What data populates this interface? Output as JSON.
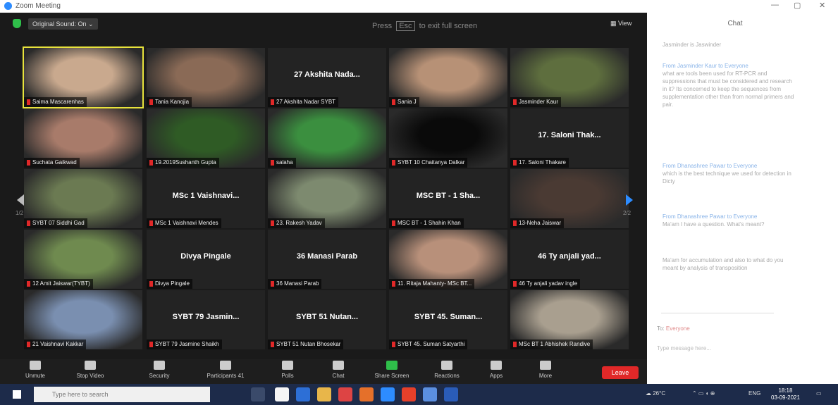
{
  "window": {
    "title": "Zoom Meeting",
    "controls": [
      "—",
      "▢",
      "✕"
    ]
  },
  "topbar": {
    "sound": "Original Sound: On  ⌄",
    "fullscreen_prefix": "Press",
    "fullscreen_key": "Esc",
    "fullscreen_suffix": "to exit full screen",
    "view": "View"
  },
  "tiles": [
    {
      "name": "Saima Mascarenhas",
      "video": true,
      "bg": "#c9a98e",
      "active": true
    },
    {
      "name": "Tania Kanojia",
      "video": true,
      "bg": "#8a6a56"
    },
    {
      "name": "27 Akshita Nadar SYBT",
      "big": "27 Akshita Nada...",
      "video": false
    },
    {
      "name": "Sania J",
      "video": true,
      "bg": "#b79176"
    },
    {
      "name": "Jasminder Kaur",
      "video": true,
      "bg": "#5e6e3e"
    },
    {
      "name": "Suchata Gaikwad",
      "video": true,
      "bg": "#a87b6a"
    },
    {
      "name": "19.2019Sushanth Gupta",
      "video": true,
      "bg": "#2f5b25"
    },
    {
      "name": "salaha",
      "video": true,
      "bg": "#3b8f3f"
    },
    {
      "name": "SYBT 10 Chaitanya Dalkar",
      "video": true,
      "bg": "#0a0a0a"
    },
    {
      "name": "17. Saloni Thakare",
      "big": "17. Saloni Thak...",
      "video": false
    },
    {
      "name": "SYBT 07 Siddhi Gad",
      "video": true,
      "bg": "#6b7a52"
    },
    {
      "name": "MSc 1 Vaishnavi Mendes",
      "big": "MSc 1 Vaishnavi...",
      "video": false
    },
    {
      "name": "23. Rakesh Yadav",
      "video": true,
      "bg": "#7d8a6f"
    },
    {
      "name": "MSC BT - 1 Shahin Khan",
      "big": "MSC BT - 1 Sha...",
      "video": false
    },
    {
      "name": "13-Neha Jaiswar",
      "video": true,
      "bg": "#4a3a33"
    },
    {
      "name": "12 Amit Jaiswar(TYBT)",
      "video": true,
      "bg": "#6f8a4f"
    },
    {
      "name": "Divya Pingale",
      "big": "Divya Pingale",
      "video": false
    },
    {
      "name": "36 Manasi Parab",
      "big": "36 Manasi Parab",
      "video": false
    },
    {
      "name": "11. Ritaja Mahanty- MSc BT...",
      "video": true,
      "bg": "#b8907a"
    },
    {
      "name": "46 Ty anjali yadav ingle",
      "big": "46 Ty anjali yad...",
      "video": false
    },
    {
      "name": "21 Vaishnavi Kakkar",
      "video": true,
      "bg": "#7a8fb0"
    },
    {
      "name": "SYBT 79 Jasmine Shaikh",
      "big": "SYBT 79 Jasmin...",
      "video": false
    },
    {
      "name": "SYBT 51 Nutan Bhosekar",
      "big": "SYBT 51 Nutan...",
      "video": false
    },
    {
      "name": "SYBT 45. Suman Satyarthi",
      "big": "SYBT 45. Suman...",
      "video": false
    },
    {
      "name": "MSc BT 1 Abhishek Randive",
      "video": true,
      "bg": "#a99f8f"
    }
  ],
  "pager": {
    "left": "1/2",
    "right": "2/2"
  },
  "toolbar": {
    "unmute": "Unmute",
    "stop_video": "Stop Video",
    "security": "Security",
    "participants": "Participants",
    "participants_count": "41",
    "polls": "Polls",
    "chat": "Chat",
    "share": "Share Screen",
    "reactions": "Reactions",
    "apps": "Apps",
    "more": "More",
    "leave": "Leave"
  },
  "chat": {
    "title": "Chat",
    "messages": [
      {
        "from": "",
        "text": "Jasminder is Jaswinder"
      },
      {
        "from": "From Jasminder Kaur to Everyone",
        "text": "what are tools been used for RT-PCR and suppressions that must be considered and research in it? Its concerned to keep the sequences from supplementation other than from normal primers and pair."
      },
      {
        "from": "From Dhanashree Pawar to Everyone",
        "text": "which is the best technique we used for detection in Dicty"
      },
      {
        "from": "From Dhanashree Pawar to Everyone",
        "text": "Ma'am I have a question. What's meant?"
      },
      {
        "from": "",
        "text": "Ma'am for accumulation and also to what do you meant by analysis of transposition"
      }
    ],
    "to_label": "To:",
    "to_value": "Everyone",
    "placeholder": "Type message here..."
  },
  "taskbar": {
    "search": "Type here to search",
    "weather": "26°C",
    "lang": "ENG",
    "time": "18:18",
    "date": "03-09-2021"
  }
}
